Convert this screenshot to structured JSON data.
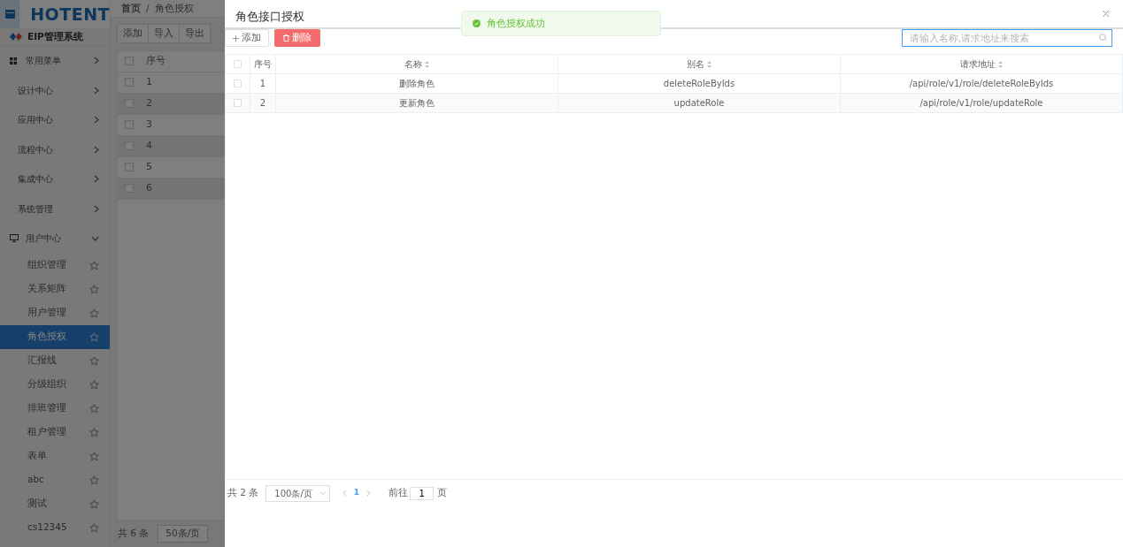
{
  "app": {
    "logo_text": "HOTENT",
    "system_name": "EIP管理系统",
    "breadcrumb": [
      "首页",
      "角色授权"
    ],
    "breadcrumb_separator": "/",
    "toolbar": [
      "添加",
      "导入",
      "导出"
    ],
    "sidebar": {
      "items": [
        {
          "label": "常用菜单",
          "kind": "top",
          "expanded": false
        },
        {
          "label": "设计中心",
          "kind": "group",
          "expanded": false
        },
        {
          "label": "应用中心",
          "kind": "group",
          "expanded": false
        },
        {
          "label": "流程中心",
          "kind": "group",
          "expanded": false
        },
        {
          "label": "集成中心",
          "kind": "group",
          "expanded": false
        },
        {
          "label": "系统管理",
          "kind": "group",
          "expanded": false
        },
        {
          "label": "用户中心",
          "kind": "top-monitor",
          "expanded": true,
          "children": [
            {
              "label": "组织管理",
              "selected": false
            },
            {
              "label": "关系矩阵",
              "selected": false
            },
            {
              "label": "用户管理",
              "selected": false
            },
            {
              "label": "角色授权",
              "selected": true
            },
            {
              "label": "汇报线",
              "selected": false
            },
            {
              "label": "分级组织",
              "selected": false
            },
            {
              "label": "排班管理",
              "selected": false
            },
            {
              "label": "租户管理",
              "selected": false
            },
            {
              "label": "表单",
              "selected": false
            },
            {
              "label": "abc",
              "selected": false
            },
            {
              "label": "测试",
              "selected": false
            },
            {
              "label": "cs12345",
              "selected": false
            }
          ]
        }
      ]
    },
    "table": {
      "select_all_checked": false,
      "columns": [
        "序号"
      ],
      "rows": [
        {
          "index": "1",
          "checked": false
        },
        {
          "index": "2",
          "checked": false
        },
        {
          "index": "3",
          "checked": false
        },
        {
          "index": "4",
          "checked": false
        },
        {
          "index": "5",
          "checked": false
        },
        {
          "index": "6",
          "checked": false
        }
      ]
    },
    "pagination": {
      "total": "共 6 条",
      "page_size": "50条/页"
    }
  },
  "drawer": {
    "title": "角色接口授权",
    "buttons": [
      {
        "label": "添加",
        "kind": "default"
      },
      {
        "label": "删除",
        "kind": "danger"
      }
    ],
    "search": {
      "placeholder": "请输入名称,请求地址来搜索"
    },
    "table": {
      "select_all_checked": false,
      "columns": [
        "序号",
        "名称",
        "别名",
        "请求地址"
      ],
      "rows": [
        {
          "index": "1",
          "name": "删除角色",
          "alias": "deleteRoleByIds",
          "url": "/api/role/v1/role/deleteRoleByIds",
          "checked": false
        },
        {
          "index": "2",
          "name": "更新角色",
          "alias": "updateRole",
          "url": "/api/role/v1/role/updateRole",
          "checked": false
        }
      ]
    },
    "pagination": {
      "total": "共 2 条",
      "page_size": "100条/页",
      "pages": [
        {
          "label": "1",
          "selected": true
        }
      ],
      "goto_label": "前往",
      "goto_value": "1",
      "goto_unit": "页"
    }
  },
  "toast": {
    "message": "角色授权成功"
  }
}
